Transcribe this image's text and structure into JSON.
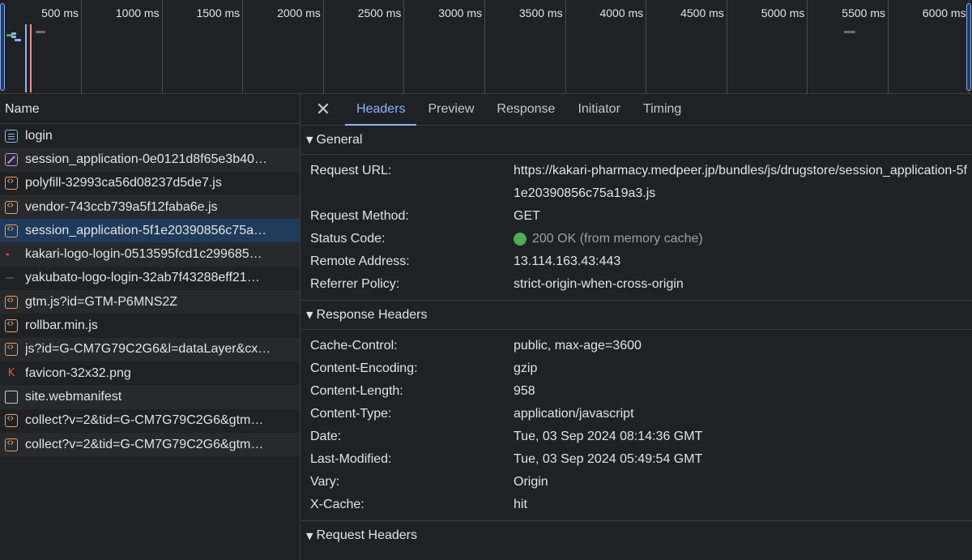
{
  "timeline": {
    "ticks": [
      "500 ms",
      "1000 ms",
      "1500 ms",
      "2000 ms",
      "2500 ms",
      "3000 ms",
      "3500 ms",
      "4000 ms",
      "4500 ms",
      "5000 ms",
      "5500 ms",
      "6000 ms"
    ]
  },
  "list": {
    "header": "Name",
    "rows": [
      {
        "name": "login",
        "icon": "document-icon"
      },
      {
        "name": "session_application-0e0121d8f65e3b40…",
        "icon": "stylesheet-icon"
      },
      {
        "name": "polyfill-32993ca56d08237d5de7.js",
        "icon": "script-icon"
      },
      {
        "name": "vendor-743ccb739a5f12faba6e.js",
        "icon": "script-icon"
      },
      {
        "name": "session_application-5f1e20390856c75a…",
        "icon": "script-icon"
      },
      {
        "name": "kakari-logo-login-0513595fcd1c299685…",
        "icon": "image-icon"
      },
      {
        "name": "yakubato-logo-login-32ab7f43288eff21…",
        "icon": "image-icon"
      },
      {
        "name": "gtm.js?id=GTM-P6MNS2Z",
        "icon": "script-icon"
      },
      {
        "name": "rollbar.min.js",
        "icon": "script-icon"
      },
      {
        "name": "js?id=G-CM7G79C2G6&l=dataLayer&cx…",
        "icon": "script-icon"
      },
      {
        "name": "favicon-32x32.png",
        "icon": "favicon-icon"
      },
      {
        "name": "site.webmanifest",
        "icon": "file-icon"
      },
      {
        "name": "collect?v=2&tid=G-CM7G79C2G6&gtm…",
        "icon": "script-icon"
      },
      {
        "name": "collect?v=2&tid=G-CM7G79C2G6&gtm…",
        "icon": "script-icon"
      }
    ],
    "selected_index": 4
  },
  "detail": {
    "close_icon": "close-icon",
    "tabs": [
      "Headers",
      "Preview",
      "Response",
      "Initiator",
      "Timing"
    ],
    "active_tab": "Headers",
    "general": {
      "title": "General",
      "request_url_label": "Request URL:",
      "request_url": "https://kakari-pharmacy.medpeer.jp/bundles/js/drugstore/session_application-5f1e20390856c75a19a3.js",
      "request_method_label": "Request Method:",
      "request_method": "GET",
      "status_code_label": "Status Code:",
      "status_code": "200 OK (from memory cache)",
      "remote_address_label": "Remote Address:",
      "remote_address": "13.114.163.43:443",
      "referrer_policy_label": "Referrer Policy:",
      "referrer_policy": "strict-origin-when-cross-origin"
    },
    "response_headers": {
      "title": "Response Headers",
      "items": [
        {
          "key": "Cache-Control:",
          "value": "public, max-age=3600"
        },
        {
          "key": "Content-Encoding:",
          "value": "gzip"
        },
        {
          "key": "Content-Length:",
          "value": "958"
        },
        {
          "key": "Content-Type:",
          "value": "application/javascript"
        },
        {
          "key": "Date:",
          "value": "Tue, 03 Sep 2024 08:14:36 GMT"
        },
        {
          "key": "Last-Modified:",
          "value": "Tue, 03 Sep 2024 05:49:54 GMT"
        },
        {
          "key": "Vary:",
          "value": "Origin"
        },
        {
          "key": "X-Cache:",
          "value": "hit"
        }
      ]
    },
    "request_headers": {
      "title": "Request Headers"
    }
  },
  "colors": {
    "accent": "#8ab4f8",
    "status_ok": "#4caf50",
    "selected_row": "#1f3a5a"
  }
}
